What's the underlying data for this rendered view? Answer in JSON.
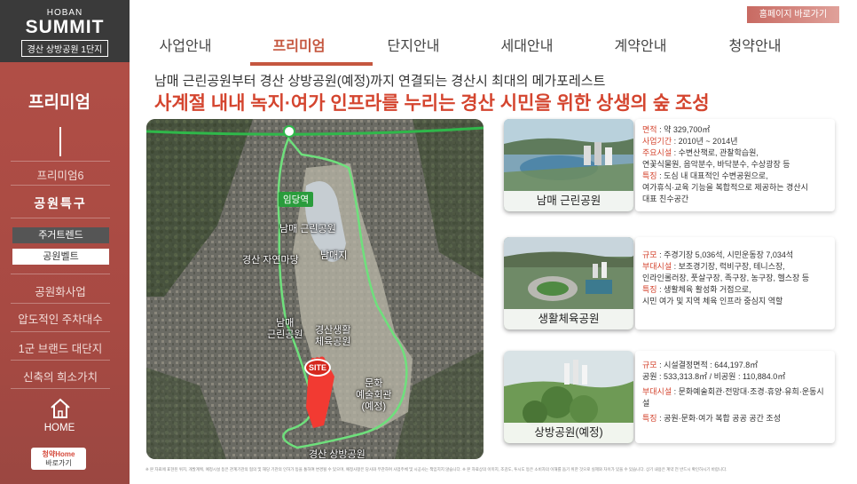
{
  "logo": {
    "brand_small": "HOBAN",
    "brand_big": "SUMMIT",
    "brand_sub": "경산 상방공원 1단지"
  },
  "header": {
    "homepage_button": "홈페이지 바로가기",
    "nav": [
      "사업안내",
      "프리미엄",
      "단지안내",
      "세대안내",
      "계약안내",
      "청약안내"
    ],
    "active_index": 1
  },
  "sidebar": {
    "title": "프리미엄",
    "items": {
      "premium6": "프리미엄6",
      "park_special": "공원특구",
      "sub_resident": "주거트렌드",
      "sub_greenbelt": "공원벨트",
      "park_business": "공원화사업",
      "parking": "압도적인 주차대수",
      "brand": "1군 브랜드 대단지",
      "new_value": "신축의 희소가치"
    },
    "home_label": "HOME",
    "hone_top": "청약Home",
    "hone_bottom": "바로가기"
  },
  "main": {
    "headline_small": "남매 근린공원부터 경산 상방공원(예정)까지 연결되는 경산시 최대의 메가포레스트",
    "headline_big": "사계절 내내 녹지·여가 인프라를 누리는 경산 시민을 위한 상생의 숲 조성"
  },
  "map": {
    "station": "임당역",
    "site": "SITE",
    "labels": {
      "nammae_park": "남매 근린공원",
      "nature_yard": "경산 자연마당",
      "nammaeji": "남매지",
      "nammae_park2": "남매\n근린공원",
      "sports": "경산생활\n체육공원",
      "culture": "문화\n예술회관\n(예정)",
      "sangbang": "경산 상방공원\n(예정)"
    }
  },
  "cards": [
    {
      "caption": "남매 근린공원",
      "lines": [
        {
          "k": "면적",
          "v": " : 약 329,700㎡"
        },
        {
          "k": "사업기간",
          "v": " : 2010년 ~ 2014년"
        },
        {
          "k": "주요시설",
          "v": " : 수변산책로, 관찰학습원,"
        },
        {
          "k": "",
          "v": "연꽃식물원, 음악분수, 바닥분수, 수상광장 등"
        },
        {
          "k": "특징",
          "v": " : 도심 내 대표적인 수변공원으로,"
        },
        {
          "k": "",
          "v": "여가휴식·교육 기능을 복합적으로 제공하는 경산시"
        },
        {
          "k": "",
          "v": "대표 친수공간"
        }
      ]
    },
    {
      "caption": "생활체육공원",
      "lines": [
        {
          "k": "규모",
          "v": " : 주경기장 5,036석, 시민운동장 7,034석"
        },
        {
          "k": "부대시설",
          "v": " : 보조경기장, 럭비구장, 테니스장,"
        },
        {
          "k": "",
          "v": "인라인롤러장, 풋살구장, 족구장, 농구장, 헬스장 등"
        },
        {
          "k": "특징",
          "v": " : 생활체육 활성화 거점으로,"
        },
        {
          "k": "",
          "v": "시민 여가 및 지역 체육 인프라 중심지 역할"
        }
      ]
    },
    {
      "caption": "상방공원(예정)",
      "lines": [
        {
          "k": "규모",
          "v": " : 시설결정면적 : 644,197.8㎡"
        },
        {
          "k": "",
          "v": "공원 : 533,313.8㎡ / 비공원 : 110,884.0㎡"
        },
        {
          "k": "부대시설",
          "v": " : 문화예술회관·전망대·조경·휴양·유희·운동시설"
        },
        {
          "k": "특징",
          "v": " : 공원·문화·여가 복합 공공 공간 조성"
        }
      ]
    }
  ],
  "footnote": "※ 본 자료에 표현된 위치, 개발계획, 예정시설 등은 관계기관의 협의 및 해당 기관의 인허가 등을 통하여 변경될 수 있으며, 예정사항은 당사와 무관하며 사업주체 및 시공사는 책임지지 않습니다. ※ 본 자료상의 이미지, 조감도, 투시도 등은 소비자의 이해를 돕기 위한 것으로 실제와 차이가 있을 수 있습니다. 상기 내용은 계약 전 반드시 확인하시기 바랍니다."
}
